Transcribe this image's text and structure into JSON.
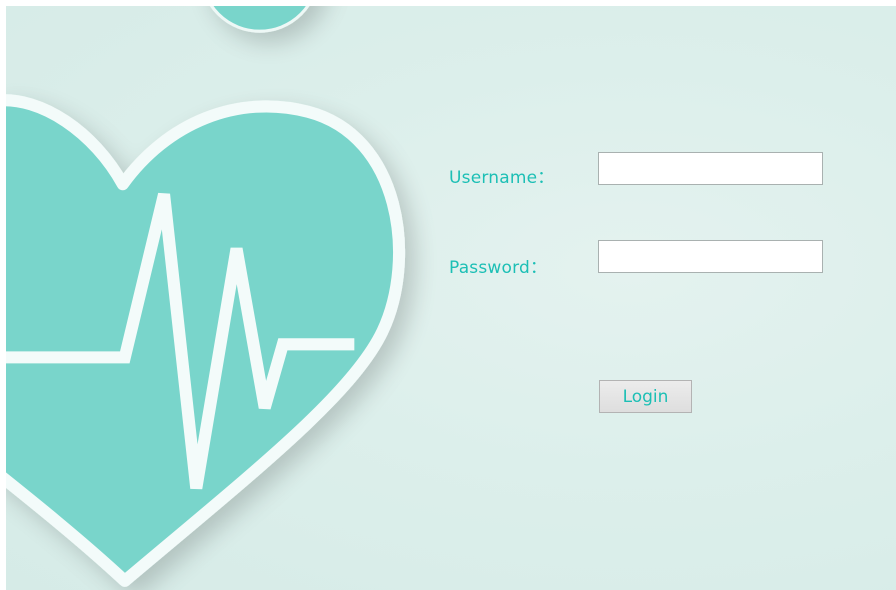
{
  "colors": {
    "accent": "#1cbfb5",
    "heart_fill": "#79d5cb",
    "heart_outline": "#f3fbfa",
    "background": "#dcefeb"
  },
  "login_form": {
    "username_label": "Username：",
    "username_value": "",
    "password_label": "Password：",
    "password_value": "",
    "login_button": "Login"
  },
  "decoration": {
    "heart_icon": "heart-with-heartbeat-icon",
    "circle": "teal-circle"
  }
}
